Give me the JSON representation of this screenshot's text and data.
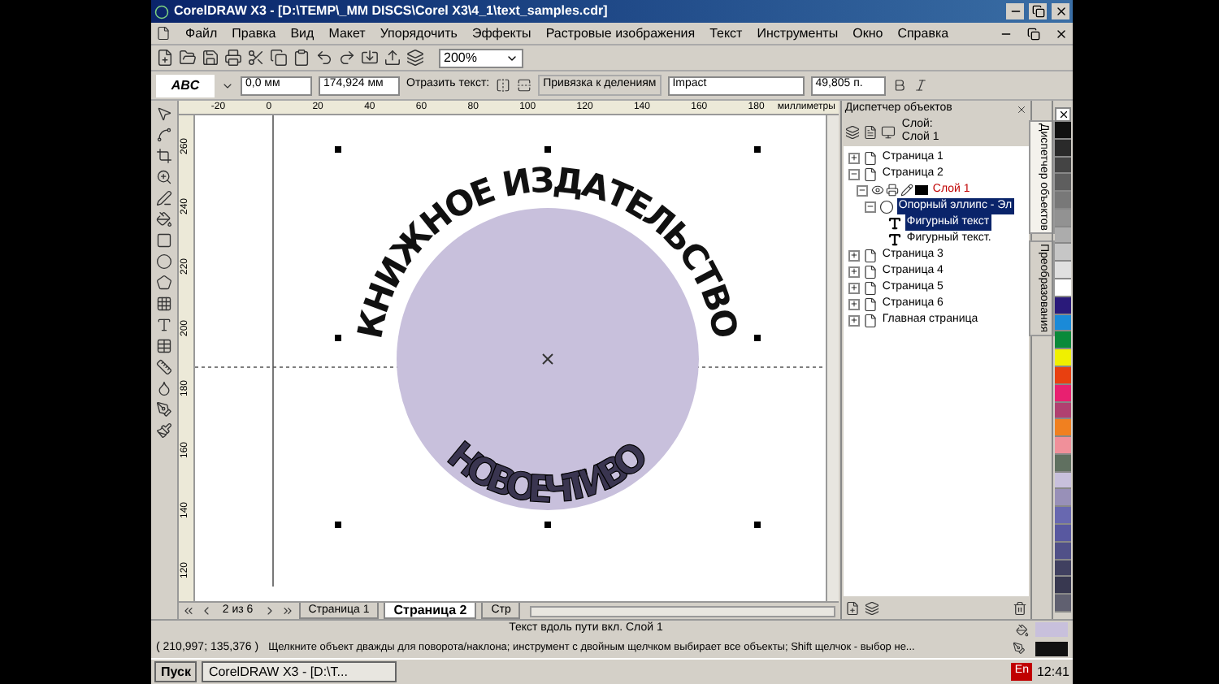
{
  "window": {
    "title": "CorelDRAW X3 - [D:\\TEMP\\_MM DISCS\\Corel X3\\4_1\\text_samples.cdr]"
  },
  "menu": [
    "Файл",
    "Правка",
    "Вид",
    "Макет",
    "Упорядочить",
    "Эффекты",
    "Растровые изображения",
    "Текст",
    "Инструменты",
    "Окно",
    "Справка"
  ],
  "toolbar": {
    "zoom": "200%"
  },
  "property_bar": {
    "preset": "ABC",
    "offset": "0,0 мм",
    "distance": "174,924 мм",
    "mirror_label": "Отразить текст:",
    "snap": "Привязка к делениям",
    "font": "Impact",
    "size": "49,805 п."
  },
  "ruler": {
    "horizontal": [
      "-20",
      "0",
      "20",
      "40",
      "60",
      "80",
      "100",
      "120",
      "140",
      "160",
      "180"
    ],
    "unit": "миллиметры",
    "vertical": [
      "260",
      "240",
      "220",
      "200",
      "180",
      "160",
      "140",
      "120"
    ]
  },
  "artwork": {
    "top_text": "КНИЖНОЕ ИЗДАТЕЛЬСТВО",
    "bottom_text": "НОВОЕЧТИВО",
    "color": "#c8c0dc"
  },
  "page_nav": {
    "counter": "2 из 6",
    "tabs": [
      {
        "label": "Страница 1",
        "selected": false
      },
      {
        "label": "Страница 2",
        "selected": true
      },
      {
        "label": "Стр",
        "selected": false
      }
    ]
  },
  "object_manager": {
    "title": "Диспетчер объектов",
    "layer_label": "Слой:",
    "layer_name": "Слой 1",
    "tree": [
      {
        "kind": "page",
        "label": "Страница 1",
        "expanded": false,
        "selected": false
      },
      {
        "kind": "page",
        "label": "Страница 2",
        "expanded": true,
        "selected": false,
        "children": [
          {
            "kind": "layer",
            "label": "Слой 1",
            "expanded": true,
            "selected": false,
            "children": [
              {
                "kind": "object",
                "label": "Опорный эллипс - Эл",
                "expanded": true,
                "selected": true,
                "children": [
                  {
                    "kind": "text",
                    "label": "Фигурный текст",
                    "selected": true
                  },
                  {
                    "kind": "text",
                    "label": "Фигурный текст.",
                    "selected": false
                  }
                ]
              }
            ]
          }
        ]
      },
      {
        "kind": "page",
        "label": "Страница 3",
        "expanded": false,
        "selected": false
      },
      {
        "kind": "page",
        "label": "Страница 4",
        "expanded": false,
        "selected": false
      },
      {
        "kind": "page",
        "label": "Страница 5",
        "expanded": false,
        "selected": false
      },
      {
        "kind": "page",
        "label": "Страница 6",
        "expanded": false,
        "selected": false
      },
      {
        "kind": "page",
        "label": "Главная страница",
        "expanded": false,
        "selected": false
      }
    ]
  },
  "side_tabs": [
    {
      "label": "Диспетчер объектов",
      "selected": true
    },
    {
      "label": "Преобразования",
      "selected": false
    }
  ],
  "palette": [
    {
      "color": "#101010"
    },
    {
      "color": "#2a2a2a"
    },
    {
      "color": "#444444"
    },
    {
      "color": "#5e5e5e"
    },
    {
      "color": "#787878"
    },
    {
      "color": "#929292"
    },
    {
      "color": "#acacac"
    },
    {
      "color": "#c6c6c6"
    },
    {
      "color": "#e0e0e0"
    },
    {
      "color": "#ffffff"
    },
    {
      "color": "#2a1a7a"
    },
    {
      "color": "#1a8ad8"
    },
    {
      "color": "#0a8a3a"
    },
    {
      "color": "#f0f000"
    },
    {
      "color": "#e84010"
    },
    {
      "color": "#e82070"
    },
    {
      "color": "#b04070"
    },
    {
      "color": "#f08020"
    },
    {
      "color": "#f0909a"
    },
    {
      "color": "#607060"
    },
    {
      "color": "#c8c0dc"
    },
    {
      "color": "#9890b8"
    },
    {
      "color": "#6868b0"
    },
    {
      "color": "#5858a0"
    },
    {
      "color": "#505088"
    },
    {
      "color": "#404060"
    },
    {
      "color": "#383850"
    },
    {
      "color": "#606070"
    }
  ],
  "status_bar": {
    "info": "Текст вдоль пути вкл. Слой 1",
    "coords": "( 210,997; 135,376 )",
    "hint": "Щелкните объект дважды для поворота/наклона; инструмент с двойным щелчком выбирает все объекты; Shift щелчок - выбор не...",
    "fill": {
      "color": "#c8c0dc"
    },
    "outline": {
      "color": "#111111"
    }
  },
  "taskbar": {
    "start": "Пуск",
    "task": "CorelDRAW X3 - [D:\\T...",
    "lang": "En",
    "time": "12:41"
  }
}
